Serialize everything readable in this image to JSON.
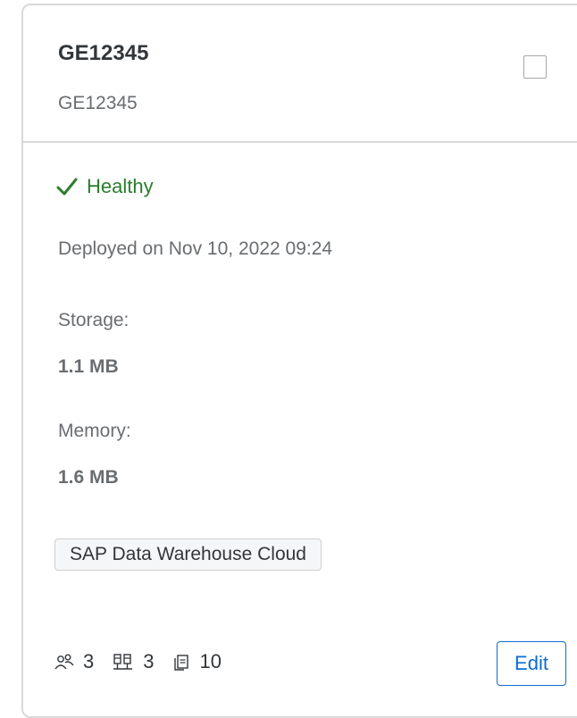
{
  "card": {
    "title": "GE12345",
    "subtitle": "GE12345",
    "status": {
      "label": "Healthy",
      "icon": "checkmark-icon",
      "color": "#2b7d2b"
    },
    "deployed_text": "Deployed on Nov 10, 2022 09:24",
    "storage": {
      "label": "Storage:",
      "value": "1.1 MB"
    },
    "memory": {
      "label": "Memory:",
      "value": "1.6 MB"
    },
    "tag": "SAP Data Warehouse Cloud",
    "counts": [
      {
        "icon": "users-icon",
        "value": "3"
      },
      {
        "icon": "connections-icon",
        "value": "3"
      },
      {
        "icon": "documents-icon",
        "value": "10"
      }
    ],
    "edit_label": "Edit",
    "accent_color": "#0a6ed1"
  }
}
